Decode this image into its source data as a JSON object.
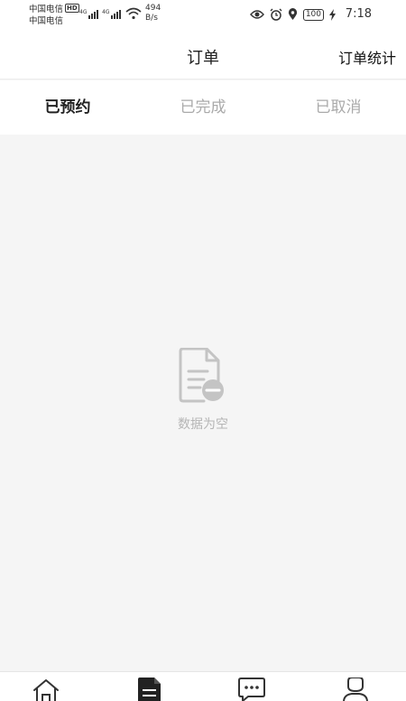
{
  "status_bar": {
    "carrier_1": "中国电信",
    "carrier_2": "中国电信",
    "hd_badge": "HD",
    "network_1": "4G",
    "network_2": "4G",
    "speed_value": "494",
    "speed_unit": "B/s",
    "battery": "100",
    "time": "7:18",
    "icons": [
      "eye-icon",
      "alarm-icon",
      "location-icon",
      "charging-icon"
    ]
  },
  "header": {
    "title": "订单",
    "stats_link": "订单统计"
  },
  "tabs": [
    {
      "label": "已预约",
      "active": true
    },
    {
      "label": "已完成",
      "active": false
    },
    {
      "label": "已取消",
      "active": false
    }
  ],
  "empty_state": {
    "icon": "empty-document-icon",
    "text": "数据为空"
  },
  "bottom_nav": {
    "items": [
      {
        "icon": "home-icon",
        "active": false
      },
      {
        "icon": "orders-icon",
        "active": true
      },
      {
        "icon": "message-icon",
        "active": false
      },
      {
        "icon": "profile-icon",
        "active": false
      }
    ]
  },
  "colors": {
    "accent_text": "#222222",
    "inactive_text": "#aaaaaa",
    "background": "#f5f5f5",
    "empty_text": "#b5b5b5"
  }
}
